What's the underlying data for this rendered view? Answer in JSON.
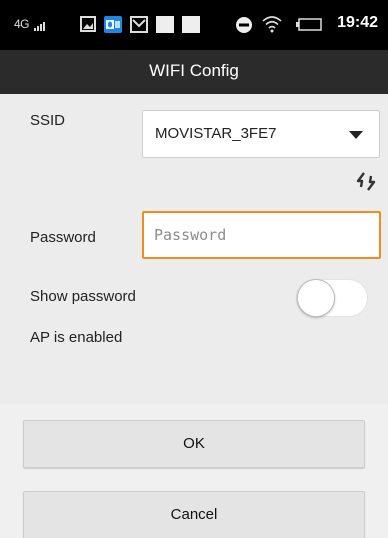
{
  "status_bar": {
    "network": "4G",
    "time": "19:42",
    "icons": [
      "signal-icon",
      "image-icon",
      "outlook-icon",
      "gmail-icon",
      "notification-icon",
      "notification-icon",
      "do-not-disturb-icon",
      "wifi-icon",
      "battery-icon"
    ]
  },
  "app_bar": {
    "title": "WIFI Config"
  },
  "form": {
    "ssid_label": "SSID",
    "ssid_value": "MOVISTAR_3FE7",
    "password_label": "Password",
    "password_placeholder": "Password",
    "password_value": "",
    "show_password_label": "Show password",
    "show_password_on": false,
    "ap_status": "AP is enabled"
  },
  "buttons": {
    "ok": "OK",
    "cancel": "Cancel"
  },
  "colors": {
    "accent": "#f28c1e",
    "action_bar": "#2b2b2b",
    "status_bar": "#000000"
  }
}
